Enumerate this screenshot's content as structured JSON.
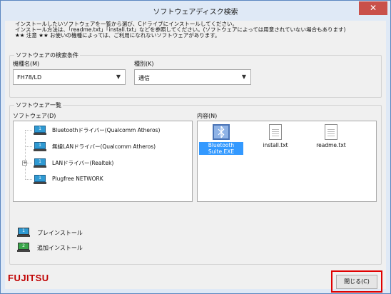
{
  "window": {
    "title": "ソフトウェアディスク検索",
    "close_glyph": "✕"
  },
  "instructions": [
    "インストールしたいソフトウェアを一覧から選び、Cドライブにインストールしてください。",
    "インストール方法は、「readme.txt」「install.txt」などを参照してください。(ソフトウェアによっては用意されていない場合もあります)",
    "★★ 注意 ★★ お使いの機種によっては、ご利用になれないソフトウェアがあります。"
  ],
  "search": {
    "group_title": "ソフトウェアの検索条件",
    "model_label": "機種名(M)",
    "model_value": "FH78/LD",
    "type_label": "種別(K)",
    "type_value": "通信"
  },
  "software_list": {
    "group_title": "ソフトウェア一覧",
    "software_label": "ソフトウェア(D)",
    "items": [
      {
        "label": "Bluetoothドライバー(Qualcomm Atheros)",
        "expandable": false
      },
      {
        "label": "無線LANドライバー(Qualcomm Atheros)",
        "expandable": false
      },
      {
        "label": "LANドライバー(Realtek)",
        "expandable": true
      },
      {
        "label": "Plugfree NETWORK",
        "expandable": false
      }
    ],
    "content_label": "内容(N)",
    "files": [
      {
        "name": "Bluetooth Suite.EXE",
        "icon": "exe-icon",
        "selected": true
      },
      {
        "name": "install.txt",
        "icon": "text-file-icon",
        "selected": false
      },
      {
        "name": "readme.txt",
        "icon": "text-file-icon",
        "selected": false
      }
    ]
  },
  "legend": {
    "preinstall": {
      "label": "プレインストール",
      "icon_text": "1",
      "color": "#2f9ad3"
    },
    "additional": {
      "label": "追加インストール",
      "icon_text": "2",
      "color": "#3aa64a"
    }
  },
  "footer": {
    "brand": "FUJITSU",
    "close_button": "閉じる(C)"
  },
  "colors": {
    "highlight": "#e00000",
    "selection": "#3399ff",
    "brand": "#c00000"
  }
}
